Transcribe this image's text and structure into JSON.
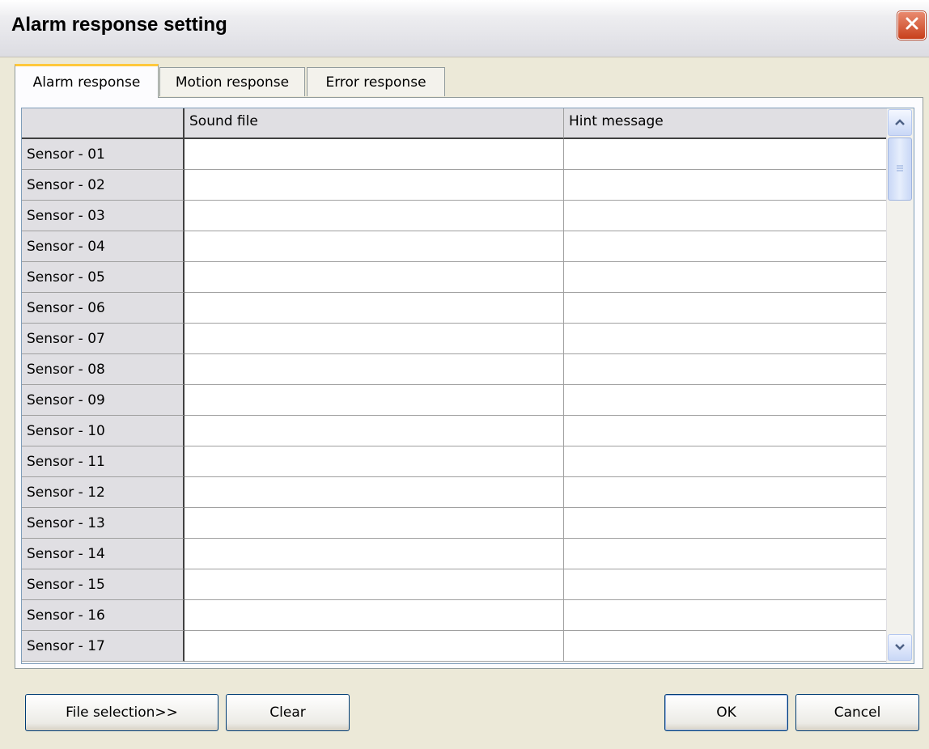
{
  "window": {
    "title": "Alarm response setting"
  },
  "tabs": [
    {
      "label": "Alarm response",
      "active": true
    },
    {
      "label": "Motion response",
      "active": false
    },
    {
      "label": "Error response",
      "active": false
    }
  ],
  "grid": {
    "columns": [
      "",
      "Sound file",
      "Hint message"
    ],
    "rows": [
      {
        "label": "Sensor - 01",
        "sound_file": "",
        "hint_message": ""
      },
      {
        "label": "Sensor - 02",
        "sound_file": "",
        "hint_message": ""
      },
      {
        "label": "Sensor - 03",
        "sound_file": "",
        "hint_message": ""
      },
      {
        "label": "Sensor - 04",
        "sound_file": "",
        "hint_message": ""
      },
      {
        "label": "Sensor - 05",
        "sound_file": "",
        "hint_message": ""
      },
      {
        "label": "Sensor - 06",
        "sound_file": "",
        "hint_message": ""
      },
      {
        "label": "Sensor - 07",
        "sound_file": "",
        "hint_message": ""
      },
      {
        "label": "Sensor - 08",
        "sound_file": "",
        "hint_message": ""
      },
      {
        "label": "Sensor - 09",
        "sound_file": "",
        "hint_message": ""
      },
      {
        "label": "Sensor - 10",
        "sound_file": "",
        "hint_message": ""
      },
      {
        "label": "Sensor - 11",
        "sound_file": "",
        "hint_message": ""
      },
      {
        "label": "Sensor - 12",
        "sound_file": "",
        "hint_message": ""
      },
      {
        "label": "Sensor - 13",
        "sound_file": "",
        "hint_message": ""
      },
      {
        "label": "Sensor - 14",
        "sound_file": "",
        "hint_message": ""
      },
      {
        "label": "Sensor - 15",
        "sound_file": "",
        "hint_message": ""
      },
      {
        "label": "Sensor - 16",
        "sound_file": "",
        "hint_message": ""
      },
      {
        "label": "Sensor - 17",
        "sound_file": "",
        "hint_message": ""
      }
    ]
  },
  "buttons": {
    "file_selection": "File selection>>",
    "clear": "Clear",
    "ok": "OK",
    "cancel": "Cancel"
  },
  "icons": {
    "close": "close-icon",
    "scroll_up": "chevron-up-icon",
    "scroll_down": "chevron-down-icon",
    "scroll_grip": "grip-icon"
  },
  "colors": {
    "close_button": "#c8401c",
    "active_tab_accent": "#ffc83c",
    "window_bg": "#ece9d8"
  }
}
